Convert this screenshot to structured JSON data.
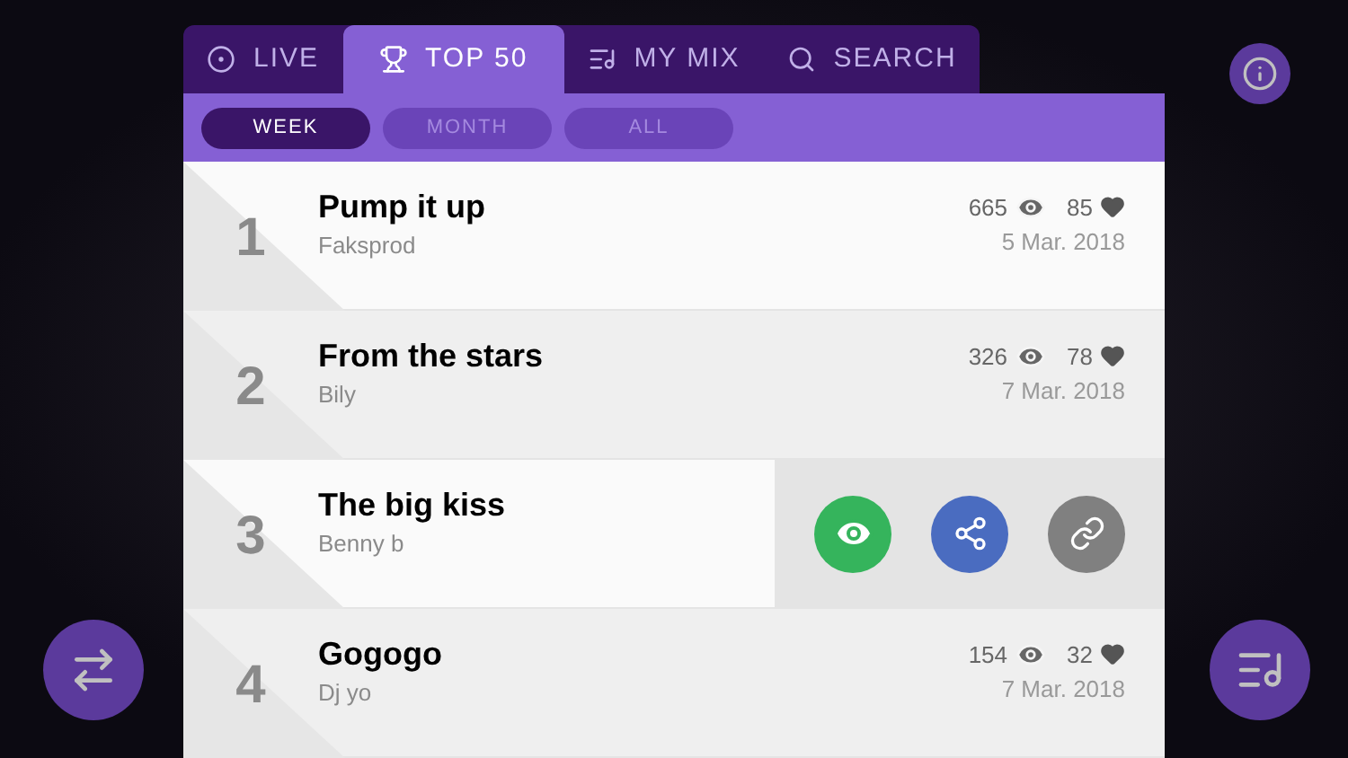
{
  "tabs": [
    {
      "label": "LIVE",
      "selected": false
    },
    {
      "label": "TOP 50",
      "selected": true
    },
    {
      "label": "MY MIX",
      "selected": false
    },
    {
      "label": "SEARCH",
      "selected": false
    }
  ],
  "filters": [
    {
      "label": "WEEK",
      "selected": true
    },
    {
      "label": "MONTH",
      "selected": false
    },
    {
      "label": "ALL",
      "selected": false
    }
  ],
  "rows": [
    {
      "kind": "stats",
      "rank": "1",
      "title": "Pump it up",
      "artist": "Faksprod",
      "views": "665",
      "likes": "85",
      "date": "5 Mar. 2018"
    },
    {
      "kind": "stats",
      "rank": "2",
      "title": "From the stars",
      "artist": "Bily",
      "views": "326",
      "likes": "78",
      "date": "7 Mar. 2018"
    },
    {
      "kind": "actions",
      "rank": "3",
      "title": "The big kiss",
      "artist": "Benny b"
    },
    {
      "kind": "stats",
      "rank": "4",
      "title": "Gogogo",
      "artist": "Dj yo",
      "views": "154",
      "likes": "32",
      "date": "7 Mar. 2018"
    }
  ]
}
